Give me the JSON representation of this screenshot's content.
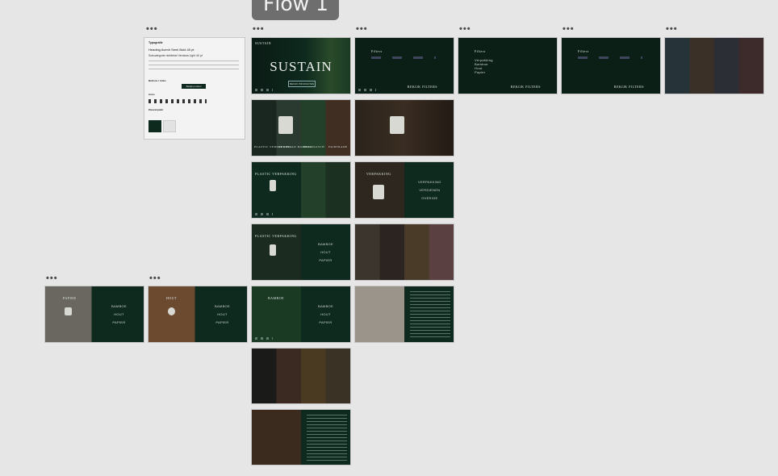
{
  "canvas": {
    "flow_label": "Flow 1",
    "more_icon": "ellipsis-icon"
  },
  "styleguide": {
    "title": "Typografie",
    "h1": "Heading Avenir Semi Bold 45 pt",
    "sub": "Subcategorie richttekst Verdana Light 40 pt",
    "buttons_title": "Buttons / Links",
    "cta": "Bekijk product",
    "icons_title": "Icons",
    "color_title": "Kleurenpalet",
    "colors": [
      "#0e2a1e",
      "#e9e9e9"
    ]
  },
  "slides": {
    "sustain": {
      "brand": "SUSTAIN",
      "hero": "SUSTAIN",
      "button": "BEKIJK PRODUCTEN"
    },
    "filter_title": "Filters",
    "filter_items": [
      "Verpakking",
      "Bamboe",
      "Hout",
      "Papier"
    ],
    "filter_link": "BEKIJK FILTERS",
    "categories": [
      "PLASTIC VERPAKKING",
      "DERBSTAN BAMBOO",
      "BIOLOGISCH",
      "FAIRTRADE"
    ],
    "plastic_title": "PLASTIC VERPAKKING",
    "verpakking_title": "VERPAKKING",
    "menu1": [
      "VERPAKKING",
      "VERDIENEN",
      "OVERIGE"
    ],
    "menu2": [
      "BAMBOE",
      "HOUT",
      "PAPIER"
    ],
    "papier_title": "PAPIER",
    "hout_title": "HOUT",
    "bamboe_title": "BAMBOE"
  }
}
